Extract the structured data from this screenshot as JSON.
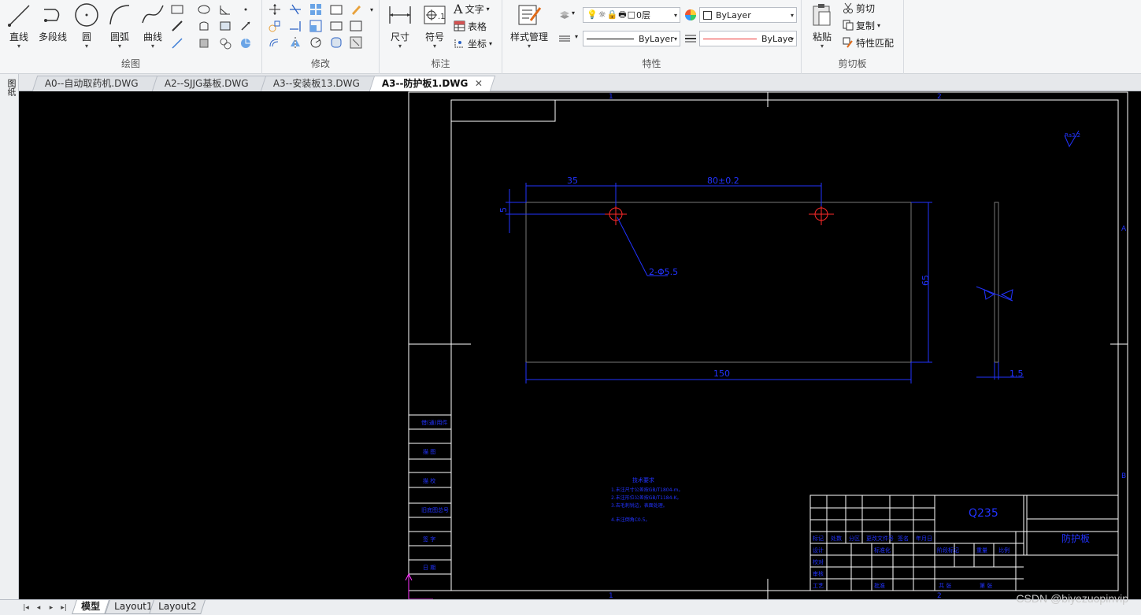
{
  "ribbon": {
    "draw": {
      "title": "绘图",
      "line": "直线",
      "polyline": "多段线",
      "circle": "圆",
      "arc": "圆弧",
      "curve": "曲线"
    },
    "modify": {
      "title": "修改"
    },
    "annotate": {
      "title": "标注",
      "dimension": "尺寸",
      "symbol": "符号",
      "text": "文字",
      "table": "表格",
      "coordinate": "坐标"
    },
    "properties": {
      "title": "特性",
      "style_manager": "样式管理",
      "layer": "0层",
      "color": "ByLayer",
      "linetype": "ByLayer",
      "lineweight": "ByLaye"
    },
    "clipboard": {
      "title": "剪切板",
      "paste": "粘贴",
      "cut": "剪切",
      "copy": "复制",
      "match": "特性匹配"
    }
  },
  "side_label": "图纸",
  "tabs": [
    {
      "label": "A0--自动取药机.DWG"
    },
    {
      "label": "A2--SJJG基板.DWG"
    },
    {
      "label": "A3--安装板13.DWG"
    },
    {
      "label": "A3--防护板1.DWG",
      "active": true
    }
  ],
  "drawing": {
    "dim_35": "35",
    "dim_80": "80±0.2",
    "dim_5": "5",
    "dim_hole": "2-Φ5.5",
    "dim_65": "65",
    "dim_150": "150",
    "dim_15": "1.5",
    "material": "Q235",
    "part_name": "防护板",
    "roughness": "Ra3.2",
    "notes_title": "技术要求",
    "notes": [
      "1.未注尺寸公差按GB/T1804-m。",
      "2.未注形位公差按GB/T1184-K。",
      "3.去毛刺锐边，表面处理。",
      "4.未注倒角C0.5。"
    ],
    "left_labels": [
      "借(通)用件",
      "描 图",
      "描 校",
      "旧底图总号",
      "签 字",
      "日 期"
    ],
    "title_cells": [
      "标记",
      "处数",
      "分区",
      "更改文件号",
      "签名",
      "年月日",
      "设计",
      "标准化",
      "校对",
      "审核",
      "工艺",
      "批准",
      "阶段标记",
      "重量",
      "比例",
      "共 张",
      "第 张"
    ]
  },
  "layouts": {
    "model": "模型",
    "layout1": "Layout1",
    "layout2": "Layout2"
  },
  "watermark": "CSDN @biyezuopinvip",
  "colors": {
    "canvas": "#000000",
    "dim_blue": "#2233ff",
    "center_red": "#ff2a2a",
    "frame_white": "#ffffff"
  }
}
